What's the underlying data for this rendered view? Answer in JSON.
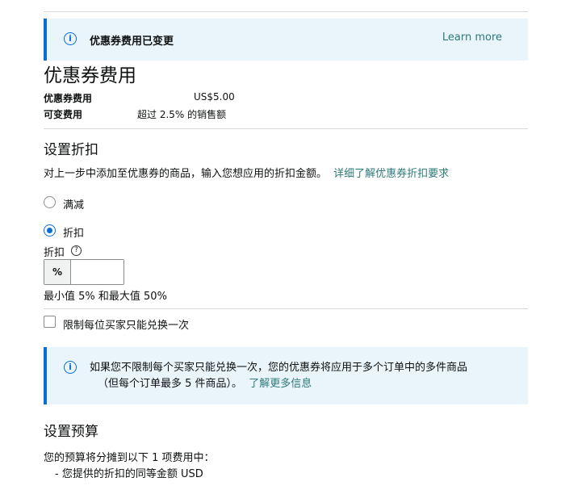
{
  "notice_fee_change": {
    "title": "优惠券费用已变更",
    "link": "Learn more"
  },
  "coupon_fees": {
    "heading": "优惠券费用",
    "fee_label": "优惠券费用",
    "fee_value": "US$5.00",
    "variable_label": "可变费用",
    "variable_value": "超过 2.5% 的销售额"
  },
  "discount": {
    "heading": "设置折扣",
    "description": "对上一步中添加至优惠券的商品，输入您想应用的折扣金额。",
    "description_link": "详细了解优惠券折扣要求",
    "options": [
      {
        "label": "满减",
        "selected": false
      },
      {
        "label": "折扣",
        "selected": true
      }
    ],
    "field_label": "折扣",
    "help_icon": "?",
    "prefix": "%",
    "value": "",
    "hint": "最小值 5% 和最大值 50%",
    "limit_checkbox_label": "限制每位买家只能兑换一次",
    "limit_checked": false
  },
  "notice_limit": {
    "line1": "如果您不限制每个买家只能兑换一次，您的优惠券将应用于多个订单中的多件商品",
    "line2": "（但每个订单最多 5 件商品）。",
    "link": "了解更多信息"
  },
  "budget": {
    "heading": "设置预算",
    "description": "您的预算将分摊到以下 1 项费用中：",
    "item": "- 您提供的折扣的同等金额 USD"
  },
  "colors": {
    "accent": "#0a6ed1",
    "link": "#2d7a78",
    "alert_bg": "#e9f4fb"
  }
}
